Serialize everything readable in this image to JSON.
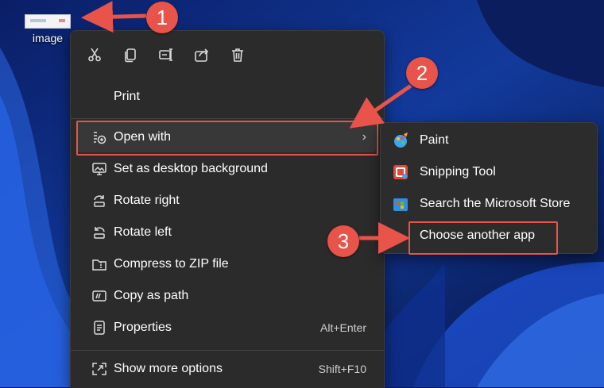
{
  "desktop": {
    "icon_label": "image"
  },
  "toolbar": [
    {
      "name": "cut-icon"
    },
    {
      "name": "copy-icon"
    },
    {
      "name": "rename-icon"
    },
    {
      "name": "share-icon"
    },
    {
      "name": "delete-icon"
    }
  ],
  "menu": {
    "print": "Print",
    "open_with": "Open with",
    "set_background": "Set as desktop background",
    "rotate_right": "Rotate right",
    "rotate_left": "Rotate left",
    "compress_zip": "Compress to ZIP file",
    "copy_path": "Copy as path",
    "properties": "Properties",
    "properties_shortcut": "Alt+Enter",
    "show_more": "Show more options",
    "show_more_shortcut": "Shift+F10",
    "chevron": "›"
  },
  "submenu": {
    "paint": "Paint",
    "snipping_tool": "Snipping Tool",
    "store": "Search the Microsoft Store",
    "choose_app": "Choose another app"
  },
  "annotations": {
    "step1": "1",
    "step2": "2",
    "step3": "3"
  },
  "colors": {
    "accent": "#e8534a",
    "menu_bg": "#2b2b2b",
    "wallpaper": "#0a1a57"
  }
}
